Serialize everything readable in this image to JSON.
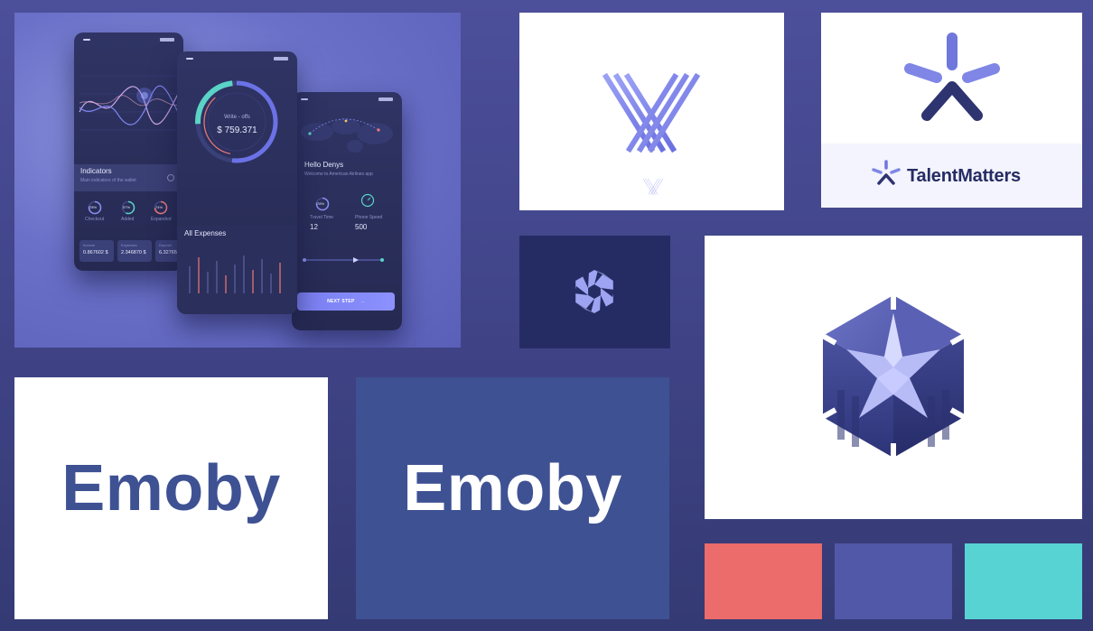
{
  "mockup": {
    "phone_left": {
      "title": "Indicators",
      "subtitle": "Main indicators of the wallet",
      "gauges": [
        {
          "value": "78%",
          "label": "Checkout"
        },
        {
          "value": "57%",
          "label": "Added"
        },
        {
          "value": "74%",
          "label": "Expanded"
        }
      ],
      "cards": [
        {
          "key": "Income",
          "value": "0.867602 $"
        },
        {
          "key": "Expenses",
          "value": "2.346870 $"
        },
        {
          "key": "Deposit",
          "value": "6.32765"
        }
      ]
    },
    "phone_middle": {
      "donut_caption": "Write - offs",
      "donut_amount": "$ 759.371",
      "section_title": "All Expenses"
    },
    "phone_right": {
      "greeting": "Hello Denys",
      "subgreeting": "Welcome to American Airlines app",
      "metrics": [
        {
          "gauge": "78%",
          "label": "Travel Time",
          "value": "12"
        },
        {
          "gauge": "",
          "label": "Phone Speed",
          "value": "500"
        }
      ],
      "button": "NEXT STEP"
    }
  },
  "logos": {
    "talent_wordmark": "TalentMatters",
    "emoby_light": "Emoby",
    "emoby_dark": "Emoby"
  },
  "colors": {
    "background": "#4c4f9a",
    "brand_navy": "#3e5193",
    "brand_periwinkle": "#8a8ff0",
    "aperture_bg": "#252c64"
  },
  "swatches": [
    "#ec6b6b",
    "#5158a8",
    "#58d3d3"
  ]
}
